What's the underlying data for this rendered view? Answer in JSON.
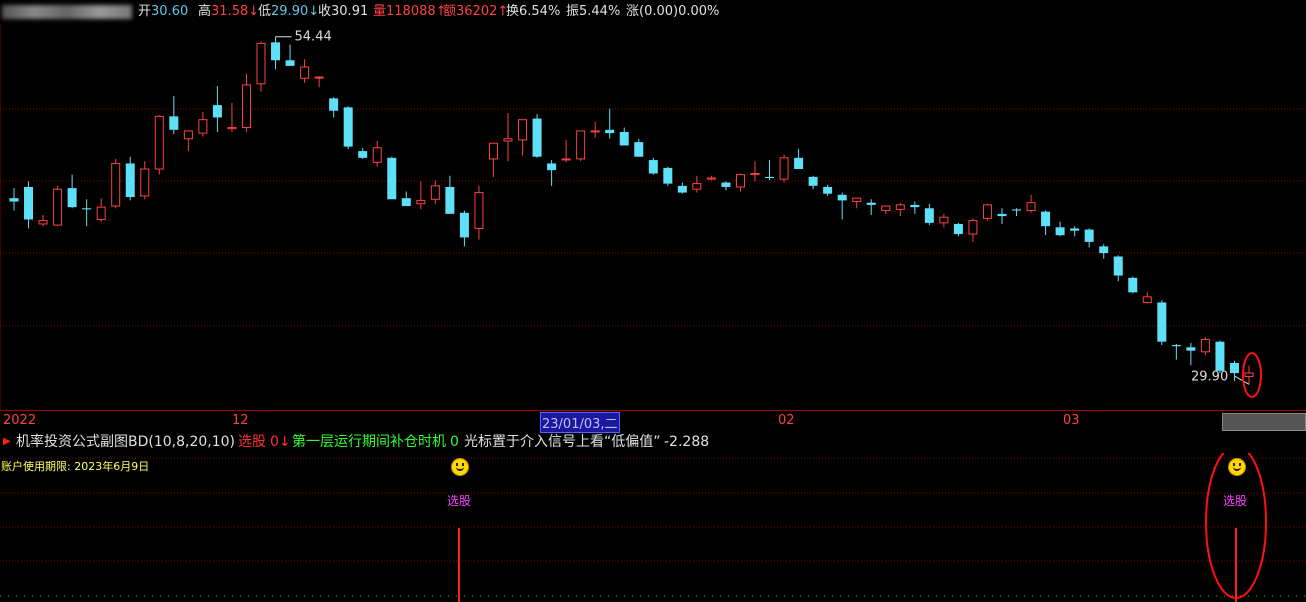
{
  "info": {
    "open_label": "开",
    "open_value": "30.60",
    "open_arrow": "↓",
    "high_label": "高",
    "high_value": "31.58",
    "high_arrow": "↓",
    "low_label": "低",
    "low_value": "29.90",
    "low_arrow": "↓",
    "close_label": "收",
    "close_value": "30.91",
    "vol_label": "量",
    "vol_value": "118088",
    "vol_arrow": "↑",
    "amt_label": "额",
    "amt_value": "36202",
    "amt_arrow": "↑",
    "turnover": "换6.54%",
    "amplitude": "振5.44%",
    "change": "涨(0.00)0.00%"
  },
  "annotations": {
    "max_label": "54.44",
    "min_label": "29.90"
  },
  "date_axis": {
    "labels": [
      "2022",
      "12",
      "02",
      "03"
    ],
    "selected": "23/01/03,二"
  },
  "indicator": {
    "marker": "▶",
    "name": "机率投资公式副图BD(10,8,20,10)",
    "item1_label": "选股",
    "item1_value": "0",
    "item1_arrow": "↓",
    "item2_label": "第一层运行期间补仓时机",
    "item2_value": "0",
    "note": "光标置于介入信号上看“低偏值”",
    "note_value": "-2.288",
    "expire": "账户使用期限: 2023年6月9日",
    "signal_label": "选股"
  },
  "colors": {
    "bull": "#ff4040",
    "bear": "#5ee0f8",
    "grid": "#8c0000",
    "signal": "#ff2020",
    "ellipse": "#ff1010"
  },
  "chart_data": {
    "type": "candlestick",
    "series": [
      {
        "o": 46.5,
        "h": 47.4,
        "l": 45.4,
        "c": 46.2
      },
      {
        "o": 47.5,
        "h": 48.0,
        "l": 43.8,
        "c": 44.6
      },
      {
        "o": 44.2,
        "h": 45.0,
        "l": 44.0,
        "c": 44.5
      },
      {
        "o": 44.1,
        "h": 47.6,
        "l": 44.0,
        "c": 47.3
      },
      {
        "o": 47.4,
        "h": 48.6,
        "l": 45.6,
        "c": 45.7
      },
      {
        "o": 45.6,
        "h": 46.4,
        "l": 44.0,
        "c": 45.5
      },
      {
        "o": 44.6,
        "h": 46.5,
        "l": 44.4,
        "c": 45.7
      },
      {
        "o": 45.8,
        "h": 50.0,
        "l": 45.6,
        "c": 49.6
      },
      {
        "o": 49.6,
        "h": 50.2,
        "l": 46.3,
        "c": 46.6
      },
      {
        "o": 46.7,
        "h": 49.8,
        "l": 46.4,
        "c": 49.1
      },
      {
        "o": 49.1,
        "h": 53.9,
        "l": 48.6,
        "c": 53.8
      },
      {
        "o": 53.8,
        "h": 55.6,
        "l": 52.2,
        "c": 52.6
      },
      {
        "o": 51.8,
        "h": 52.3,
        "l": 50.7,
        "c": 52.5
      },
      {
        "o": 52.3,
        "h": 54.2,
        "l": 52.0,
        "c": 53.5
      },
      {
        "o": 54.8,
        "h": 56.5,
        "l": 52.4,
        "c": 53.7
      },
      {
        "o": 52.7,
        "h": 55.0,
        "l": 52.4,
        "c": 52.8
      },
      {
        "o": 52.8,
        "h": 57.6,
        "l": 52.4,
        "c": 56.6
      },
      {
        "o": 56.7,
        "h": 60.5,
        "l": 56.0,
        "c": 60.3
      },
      {
        "o": 60.4,
        "h": 60.9,
        "l": 58.0,
        "c": 58.8
      },
      {
        "o": 58.8,
        "h": 60.2,
        "l": 58.3,
        "c": 58.3
      },
      {
        "o": 57.2,
        "h": 58.9,
        "l": 56.8,
        "c": 58.2
      },
      {
        "o": 57.3,
        "h": 57.4,
        "l": 56.4,
        "c": 57.3
      },
      {
        "o": 55.4,
        "h": 55.5,
        "l": 53.7,
        "c": 54.3
      },
      {
        "o": 54.6,
        "h": 54.7,
        "l": 50.9,
        "c": 51.1
      },
      {
        "o": 50.7,
        "h": 51.0,
        "l": 50.0,
        "c": 50.1
      },
      {
        "o": 49.7,
        "h": 51.6,
        "l": 49.3,
        "c": 51.0
      },
      {
        "o": 50.1,
        "h": 50.2,
        "l": 46.5,
        "c": 46.4
      },
      {
        "o": 46.5,
        "h": 47.1,
        "l": 45.8,
        "c": 45.8
      },
      {
        "o": 46.0,
        "h": 48.0,
        "l": 45.5,
        "c": 46.3
      },
      {
        "o": 46.4,
        "h": 48.1,
        "l": 46.0,
        "c": 47.6
      },
      {
        "o": 47.5,
        "h": 48.5,
        "l": 45.6,
        "c": 45.1
      },
      {
        "o": 45.2,
        "h": 45.4,
        "l": 42.2,
        "c": 43.0
      },
      {
        "o": 43.8,
        "h": 47.6,
        "l": 42.8,
        "c": 47.0
      },
      {
        "o": 50.0,
        "h": 51.1,
        "l": 48.4,
        "c": 51.4
      },
      {
        "o": 51.6,
        "h": 54.1,
        "l": 49.8,
        "c": 51.8
      },
      {
        "o": 51.7,
        "h": 53.1,
        "l": 50.3,
        "c": 53.5
      },
      {
        "o": 53.6,
        "h": 54.0,
        "l": 50.1,
        "c": 50.2
      },
      {
        "o": 49.6,
        "h": 49.9,
        "l": 47.6,
        "c": 49.0
      },
      {
        "o": 50.0,
        "h": 51.7,
        "l": 49.7,
        "c": 50.0
      },
      {
        "o": 50.0,
        "h": 52.2,
        "l": 49.8,
        "c": 52.5
      },
      {
        "o": 52.5,
        "h": 53.3,
        "l": 51.9,
        "c": 52.5
      },
      {
        "o": 52.6,
        "h": 54.5,
        "l": 51.8,
        "c": 52.3
      },
      {
        "o": 52.4,
        "h": 52.8,
        "l": 51.2,
        "c": 51.2
      },
      {
        "o": 51.5,
        "h": 51.8,
        "l": 50.2,
        "c": 50.2
      },
      {
        "o": 49.9,
        "h": 50.1,
        "l": 48.6,
        "c": 48.7
      },
      {
        "o": 49.2,
        "h": 49.3,
        "l": 47.6,
        "c": 47.8
      },
      {
        "o": 47.6,
        "h": 47.9,
        "l": 46.9,
        "c": 47.0
      },
      {
        "o": 47.3,
        "h": 48.5,
        "l": 47.0,
        "c": 47.8
      },
      {
        "o": 48.2,
        "h": 48.5,
        "l": 48.1,
        "c": 48.3
      },
      {
        "o": 47.9,
        "h": 48.0,
        "l": 47.2,
        "c": 47.5
      },
      {
        "o": 47.5,
        "h": 48.7,
        "l": 47.1,
        "c": 48.6
      },
      {
        "o": 48.6,
        "h": 49.8,
        "l": 48.0,
        "c": 48.7
      },
      {
        "o": 48.4,
        "h": 49.9,
        "l": 48.1,
        "c": 48.3
      },
      {
        "o": 48.2,
        "h": 50.4,
        "l": 47.9,
        "c": 50.1
      },
      {
        "o": 50.1,
        "h": 50.9,
        "l": 49.1,
        "c": 49.1
      },
      {
        "o": 48.4,
        "h": 48.5,
        "l": 47.3,
        "c": 47.6
      },
      {
        "o": 47.5,
        "h": 47.7,
        "l": 46.7,
        "c": 46.9
      },
      {
        "o": 46.8,
        "h": 47.0,
        "l": 44.6,
        "c": 46.3
      },
      {
        "o": 46.2,
        "h": 46.5,
        "l": 45.6,
        "c": 46.5
      },
      {
        "o": 46.1,
        "h": 46.4,
        "l": 45.0,
        "c": 45.9
      },
      {
        "o": 45.4,
        "h": 45.6,
        "l": 45.1,
        "c": 45.8
      },
      {
        "o": 45.5,
        "h": 46.1,
        "l": 44.9,
        "c": 45.9
      },
      {
        "o": 45.9,
        "h": 46.2,
        "l": 45.1,
        "c": 45.7
      },
      {
        "o": 45.6,
        "h": 46.0,
        "l": 44.1,
        "c": 44.3
      },
      {
        "o": 44.3,
        "h": 45.1,
        "l": 43.9,
        "c": 44.8
      },
      {
        "o": 44.2,
        "h": 44.3,
        "l": 43.1,
        "c": 43.3
      },
      {
        "o": 43.3,
        "h": 44.7,
        "l": 42.6,
        "c": 44.5
      },
      {
        "o": 44.7,
        "h": 46.0,
        "l": 44.5,
        "c": 45.9
      },
      {
        "o": 45.1,
        "h": 45.6,
        "l": 44.2,
        "c": 44.9
      },
      {
        "o": 45.5,
        "h": 45.6,
        "l": 44.9,
        "c": 45.4
      },
      {
        "o": 45.4,
        "h": 46.8,
        "l": 45.2,
        "c": 46.1
      },
      {
        "o": 45.3,
        "h": 45.4,
        "l": 43.2,
        "c": 44.0
      },
      {
        "o": 43.9,
        "h": 44.4,
        "l": 43.1,
        "c": 43.2
      },
      {
        "o": 43.8,
        "h": 44.0,
        "l": 43.1,
        "c": 43.6
      },
      {
        "o": 43.7,
        "h": 43.8,
        "l": 42.1,
        "c": 42.6
      },
      {
        "o": 42.2,
        "h": 42.4,
        "l": 41.1,
        "c": 41.6
      },
      {
        "o": 41.3,
        "h": 41.4,
        "l": 39.1,
        "c": 39.6
      },
      {
        "o": 39.4,
        "h": 39.5,
        "l": 38.0,
        "c": 38.1
      },
      {
        "o": 37.2,
        "h": 38.1,
        "l": 37.1,
        "c": 37.7
      },
      {
        "o": 37.2,
        "h": 37.4,
        "l": 33.4,
        "c": 33.7
      },
      {
        "o": 33.4,
        "h": 33.5,
        "l": 32.1,
        "c": 33.3
      },
      {
        "o": 33.2,
        "h": 33.6,
        "l": 31.6,
        "c": 32.9
      },
      {
        "o": 32.8,
        "h": 34.1,
        "l": 32.5,
        "c": 33.9
      },
      {
        "o": 33.7,
        "h": 33.8,
        "l": 30.9,
        "c": 31.1
      },
      {
        "o": 31.8,
        "h": 32.0,
        "l": 30.2,
        "c": 30.9
      },
      {
        "o": 30.6,
        "h": 31.58,
        "l": 29.9,
        "c": 30.91
      }
    ],
    "ylim": [
      28.5,
      61.5
    ],
    "signals_at_index": [
      30,
      85
    ]
  }
}
